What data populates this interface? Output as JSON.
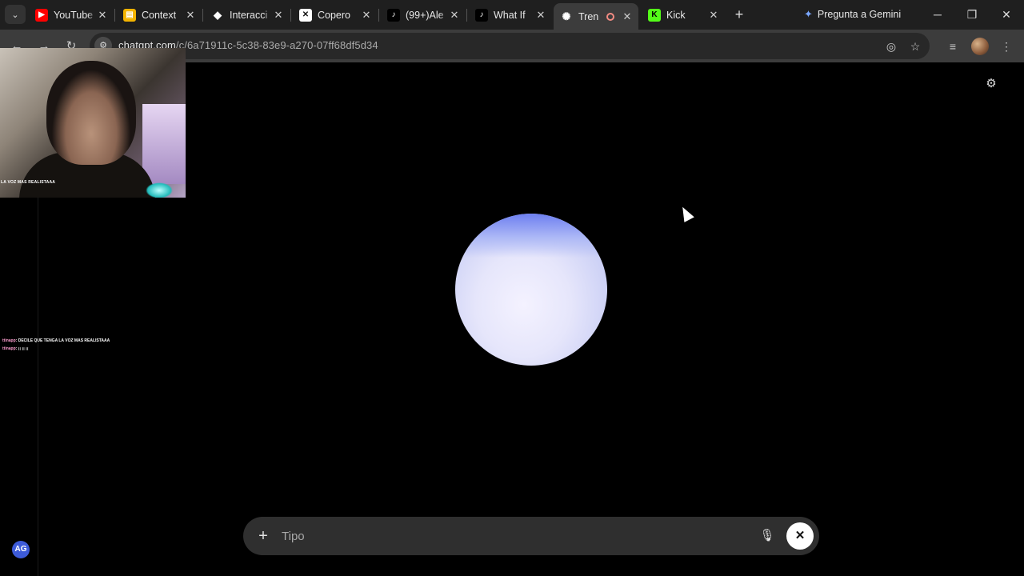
{
  "browser": {
    "tabs": [
      {
        "title": "YouTube",
        "icon": "youtube-icon",
        "color": "#ff0000",
        "glyph": "▶"
      },
      {
        "title": "Context",
        "icon": "docs-icon",
        "color": "#f4b400",
        "glyph": "▤"
      },
      {
        "title": "Interacci",
        "icon": "git-icon",
        "color": "#ffffff",
        "glyph": "◆"
      },
      {
        "title": "Copero",
        "icon": "copero-icon",
        "color": "#ffffff",
        "glyph": "✕"
      },
      {
        "title": "(99+)Ale",
        "icon": "tiktok-icon",
        "color": "#000000",
        "glyph": "♪"
      },
      {
        "title": "What If",
        "icon": "tiktok-icon",
        "color": "#000000",
        "glyph": "♪"
      },
      {
        "title": "Tren",
        "icon": "chatgpt-icon",
        "color": "#ffffff",
        "glyph": "✺",
        "active": true
      },
      {
        "title": "Kick",
        "icon": "kick-icon",
        "color": "#53fc18",
        "glyph": "K"
      }
    ],
    "gemini_label": "Pregunta a Gemini",
    "url_host": "chatgpt.com",
    "url_path": "/c/6a71911c-5c38-83e9-a270-07ff68df5d34"
  },
  "stream": {
    "webcam_caption": "LA VOZ MAS REALISTAAA",
    "chat": [
      {
        "user": "ttinapp",
        "text": ": DECILE QUE TENGA LA VOZ MAS REALISTAAA"
      },
      {
        "user": "ttinapp",
        "text": ": ¡¡ ¡¡ ¡¡"
      }
    ]
  },
  "voice": {
    "input_placeholder": "Tipo",
    "avatar_initials": "AG",
    "orb_colors": [
      "#6d7ff0",
      "#e6e6fb"
    ]
  }
}
